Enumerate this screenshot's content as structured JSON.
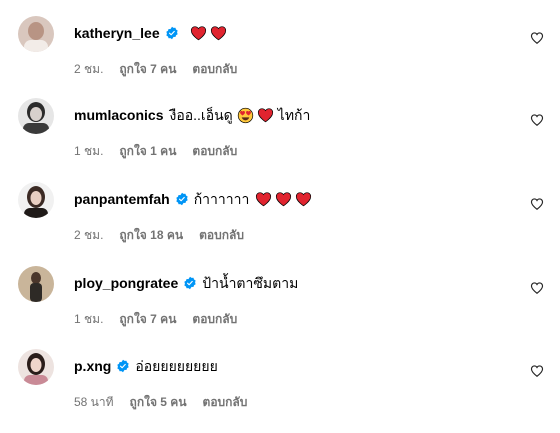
{
  "colors": {
    "verified": "#0095f6",
    "heart": "#e0242f",
    "meta_text": "#737373"
  },
  "comments": [
    {
      "username": "katheryn_lee",
      "verified": true,
      "text": "",
      "emojis": [
        "red-heart",
        "red-heart"
      ],
      "text_after": "",
      "time": "2 ชม.",
      "likes": "ถูกใจ 7 คน",
      "reply": "ตอบกลับ",
      "like_icon": "heart-outline-icon"
    },
    {
      "username": "mumlaconics",
      "verified": false,
      "text": "งืออ..เอ็นดู",
      "emojis": [
        "heart-eyes-face",
        "red-heart"
      ],
      "text_after": "ไทก้า",
      "time": "1 ชม.",
      "likes": "ถูกใจ 1 คน",
      "reply": "ตอบกลับ",
      "like_icon": "heart-outline-icon"
    },
    {
      "username": "panpantemfah",
      "verified": true,
      "text": "ก้าาาาาา",
      "emojis": [
        "red-heart",
        "red-heart",
        "red-heart"
      ],
      "text_after": "",
      "time": "2 ชม.",
      "likes": "ถูกใจ 18 คน",
      "reply": "ตอบกลับ",
      "like_icon": "heart-outline-icon"
    },
    {
      "username": "ploy_pongratee",
      "verified": true,
      "text": "ป้าน้ำตาซึมตาม",
      "emojis": [],
      "text_after": "",
      "time": "1 ชม.",
      "likes": "ถูกใจ 7 คน",
      "reply": "ตอบกลับ",
      "like_icon": "heart-outline-icon"
    },
    {
      "username": "p.xng",
      "verified": true,
      "text": "อ่อยยยยยยยย",
      "emojis": [],
      "text_after": "",
      "time": "58 นาที",
      "likes": "ถูกใจ 5 คน",
      "reply": "ตอบกลับ",
      "like_icon": "heart-outline-icon"
    }
  ]
}
